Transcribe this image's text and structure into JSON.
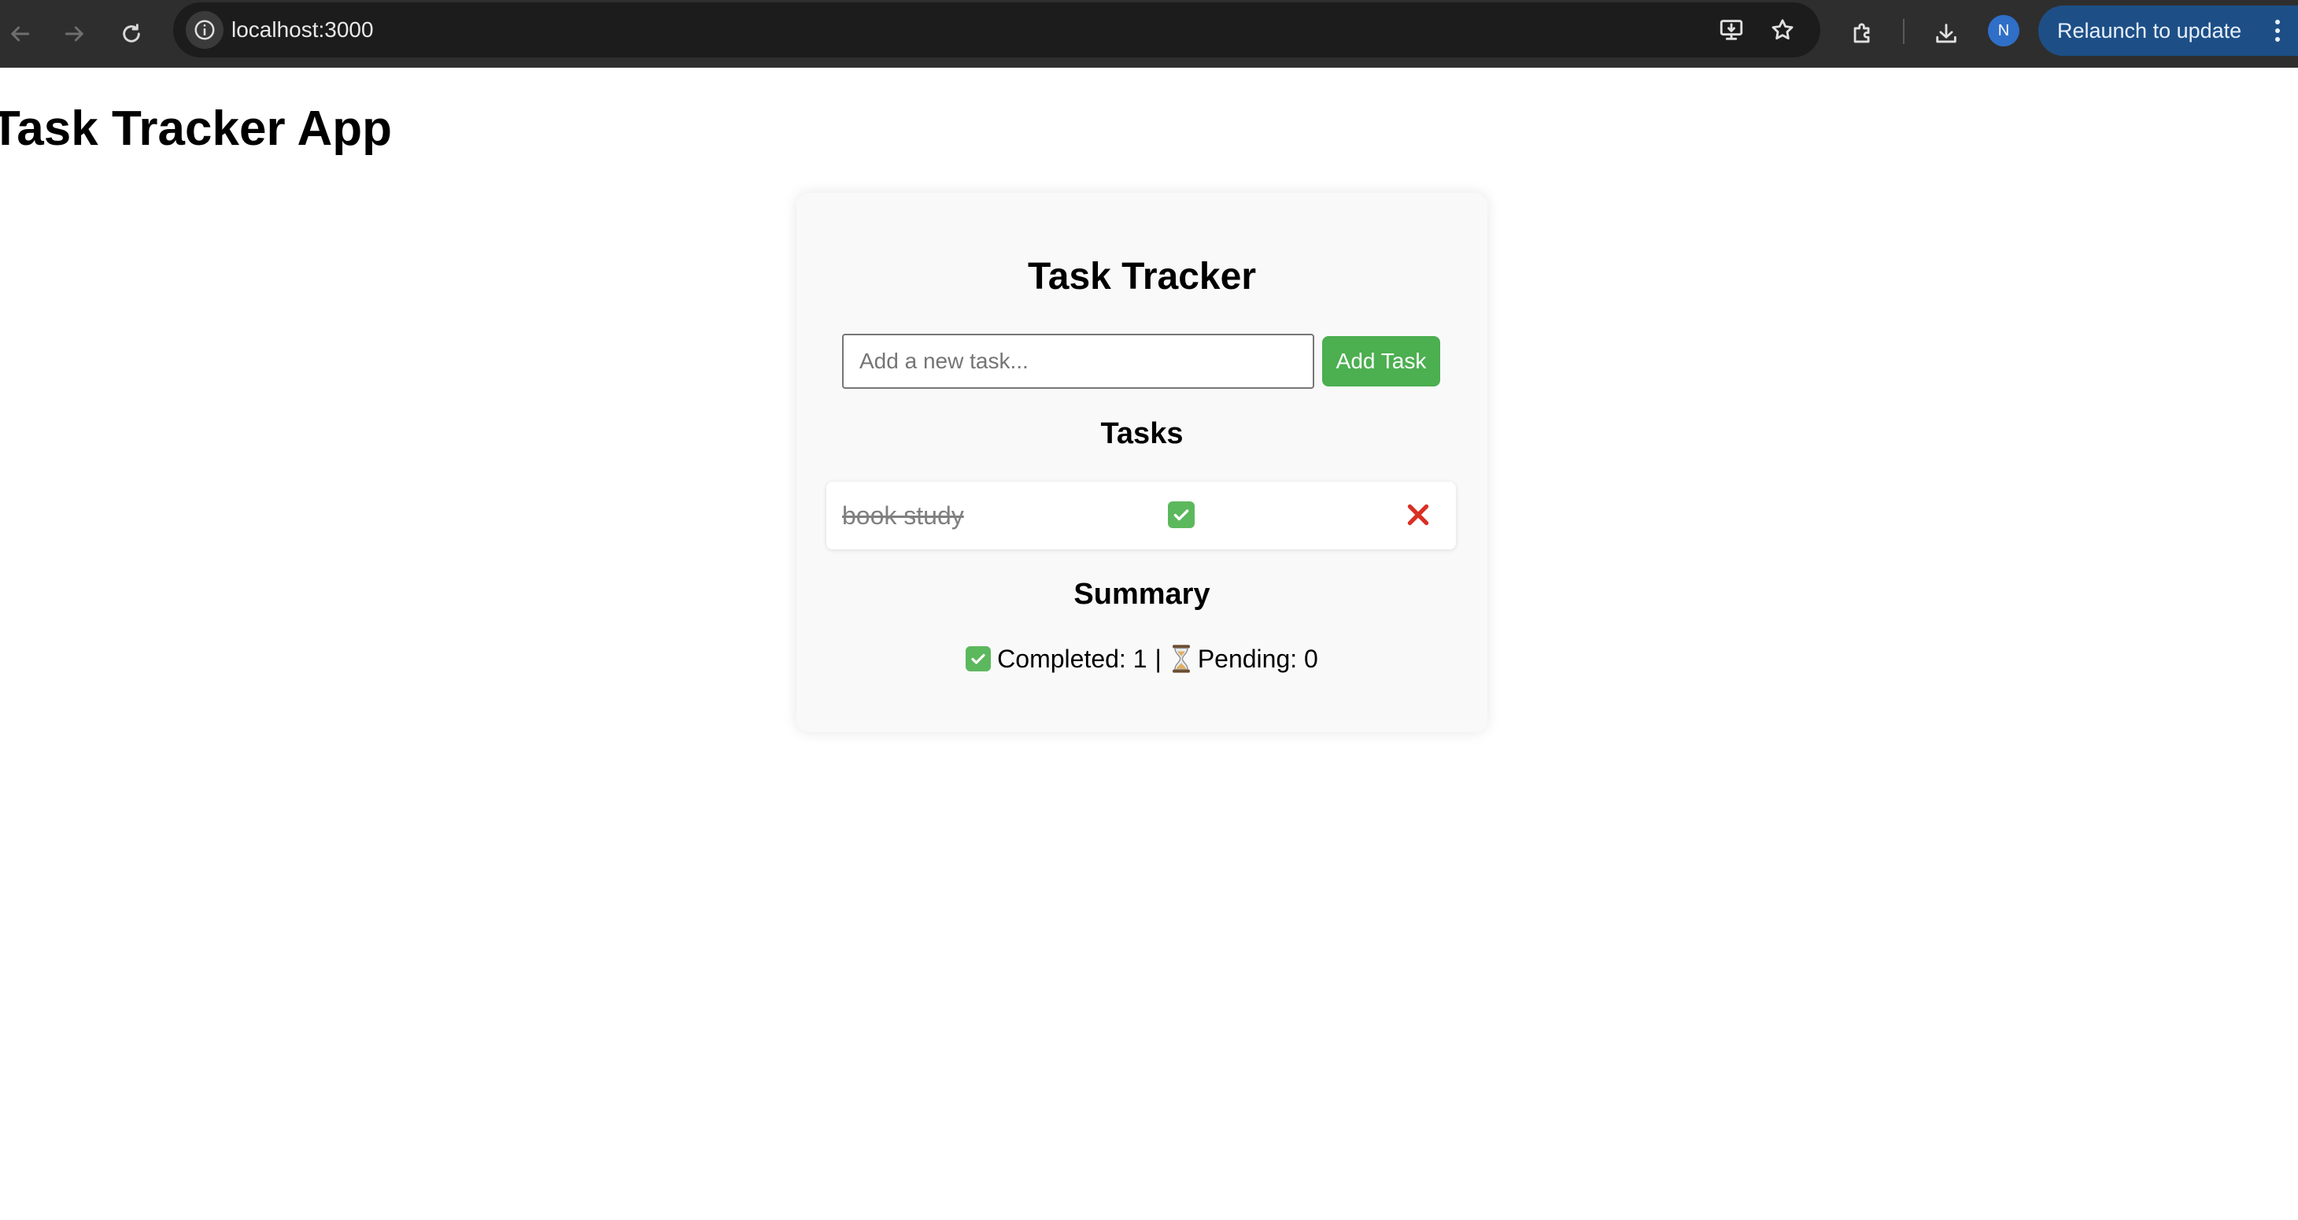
{
  "browser": {
    "url": "localhost:3000",
    "relaunch_label": "Relaunch to update",
    "profile_initial": "N",
    "icons": [
      "back-icon",
      "forward-icon",
      "reload-icon",
      "site-info-icon",
      "install-app-icon",
      "bookmark-star-icon",
      "extensions-icon",
      "downloads-icon",
      "more-menu-icon"
    ]
  },
  "page": {
    "title": "Task Tracker App"
  },
  "tracker": {
    "heading": "Task Tracker",
    "input_placeholder": "Add a new task...",
    "input_value": "",
    "add_button_label": "Add Task",
    "tasks_heading": "Tasks",
    "tasks": [
      {
        "text": "book study",
        "completed": true,
        "status_icon": "check-mark-icon",
        "delete_icon": "cross-mark-icon"
      }
    ],
    "summary_heading": "Summary",
    "summary": {
      "completed_label": "Completed: 1",
      "separator": "|",
      "pending_label": "Pending: 0"
    }
  },
  "colors": {
    "chrome_bg": "#2e2e2e",
    "omnibox_bg": "#1c1c1c",
    "relaunch_bg": "#1d4f86",
    "add_button_bg": "#4caf50",
    "delete_red": "#d93025",
    "check_green": "#5cb85c"
  }
}
